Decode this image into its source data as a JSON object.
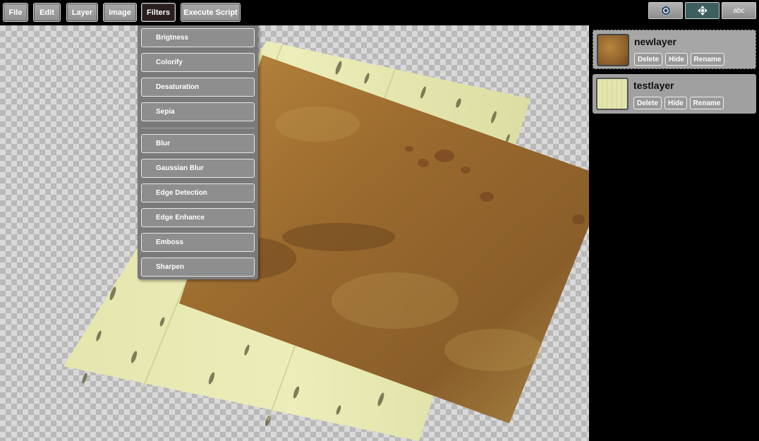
{
  "menu": {
    "file": "File",
    "edit": "Edit",
    "layer": "Layer",
    "image": "Image",
    "filters": "Filters",
    "execute_script": "Execute Script"
  },
  "tools": {
    "text": "abc"
  },
  "filters_menu": {
    "items": [
      "Brigtness",
      "Colorify",
      "Desaturation",
      "Sepia",
      "Blur",
      "Gaussian Blur",
      "Edge Detection",
      "Edge Enhance",
      "Emboss",
      "Sharpen"
    ]
  },
  "layers": [
    {
      "name": "newlayer",
      "delete": "Delete",
      "hide": "Hide",
      "rename": "Rename",
      "selected": true
    },
    {
      "name": "testlayer",
      "delete": "Delete",
      "hide": "Hide",
      "rename": "Rename",
      "selected": false
    }
  ],
  "colors": {
    "accent_active": "#3c5e5f",
    "menu_active": "#2a1e1e"
  }
}
